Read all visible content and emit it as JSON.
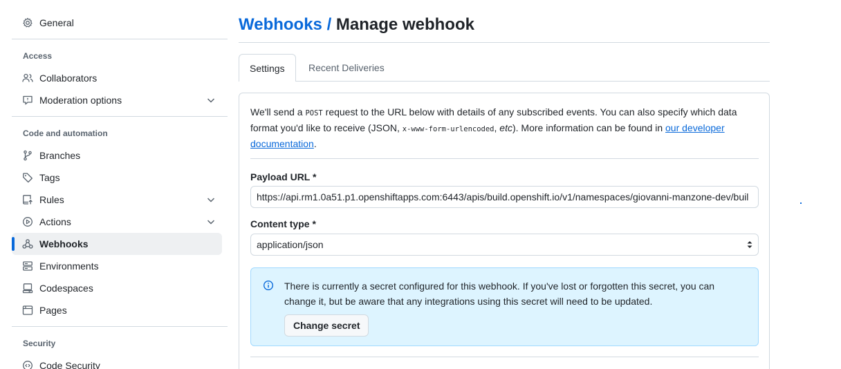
{
  "sidebar": {
    "general": "General",
    "sections": [
      {
        "heading": "Access"
      },
      {
        "heading": "Code and automation"
      },
      {
        "heading": "Security"
      }
    ],
    "items": {
      "collaborators": "Collaborators",
      "moderation": "Moderation options",
      "branches": "Branches",
      "tags": "Tags",
      "rules": "Rules",
      "actions": "Actions",
      "webhooks": "Webhooks",
      "environments": "Environments",
      "codespaces": "Codespaces",
      "pages": "Pages",
      "code_security": "Code Security"
    },
    "active_item": "webhooks",
    "accent_color": "#0969da"
  },
  "header": {
    "breadcrumb": "Webhooks",
    "separator": "/",
    "title": "Manage webhook"
  },
  "tabs": [
    {
      "label": "Settings",
      "selected": true
    },
    {
      "label": "Recent Deliveries",
      "selected": false
    }
  ],
  "intro": {
    "part1": "We'll send a ",
    "code1": "POST",
    "part2": " request to the URL below with details of any subscribed events. You can also specify which data format you'd like to receive (JSON, ",
    "code2": "x-www-form-urlencoded",
    "part3": ", ",
    "emph": "etc",
    "part4": "). More information can be found in ",
    "link": "our developer documentation",
    "part5": "."
  },
  "form": {
    "payload_label": "Payload URL *",
    "payload_value": "https://api.rm1.0a51.p1.openshiftapps.com:6443/apis/build.openshift.io/v1/namespaces/giovanni-manzone-dev/buil",
    "content_type_label": "Content type *",
    "content_type_value": "application/json"
  },
  "flash": {
    "message": "There is currently a secret configured for this webhook. If you've lost or forgotten this secret, you can change it, but be aware that any integrations using this secret will need to be updated.",
    "button": "Change secret",
    "background": "#ddf4ff"
  }
}
